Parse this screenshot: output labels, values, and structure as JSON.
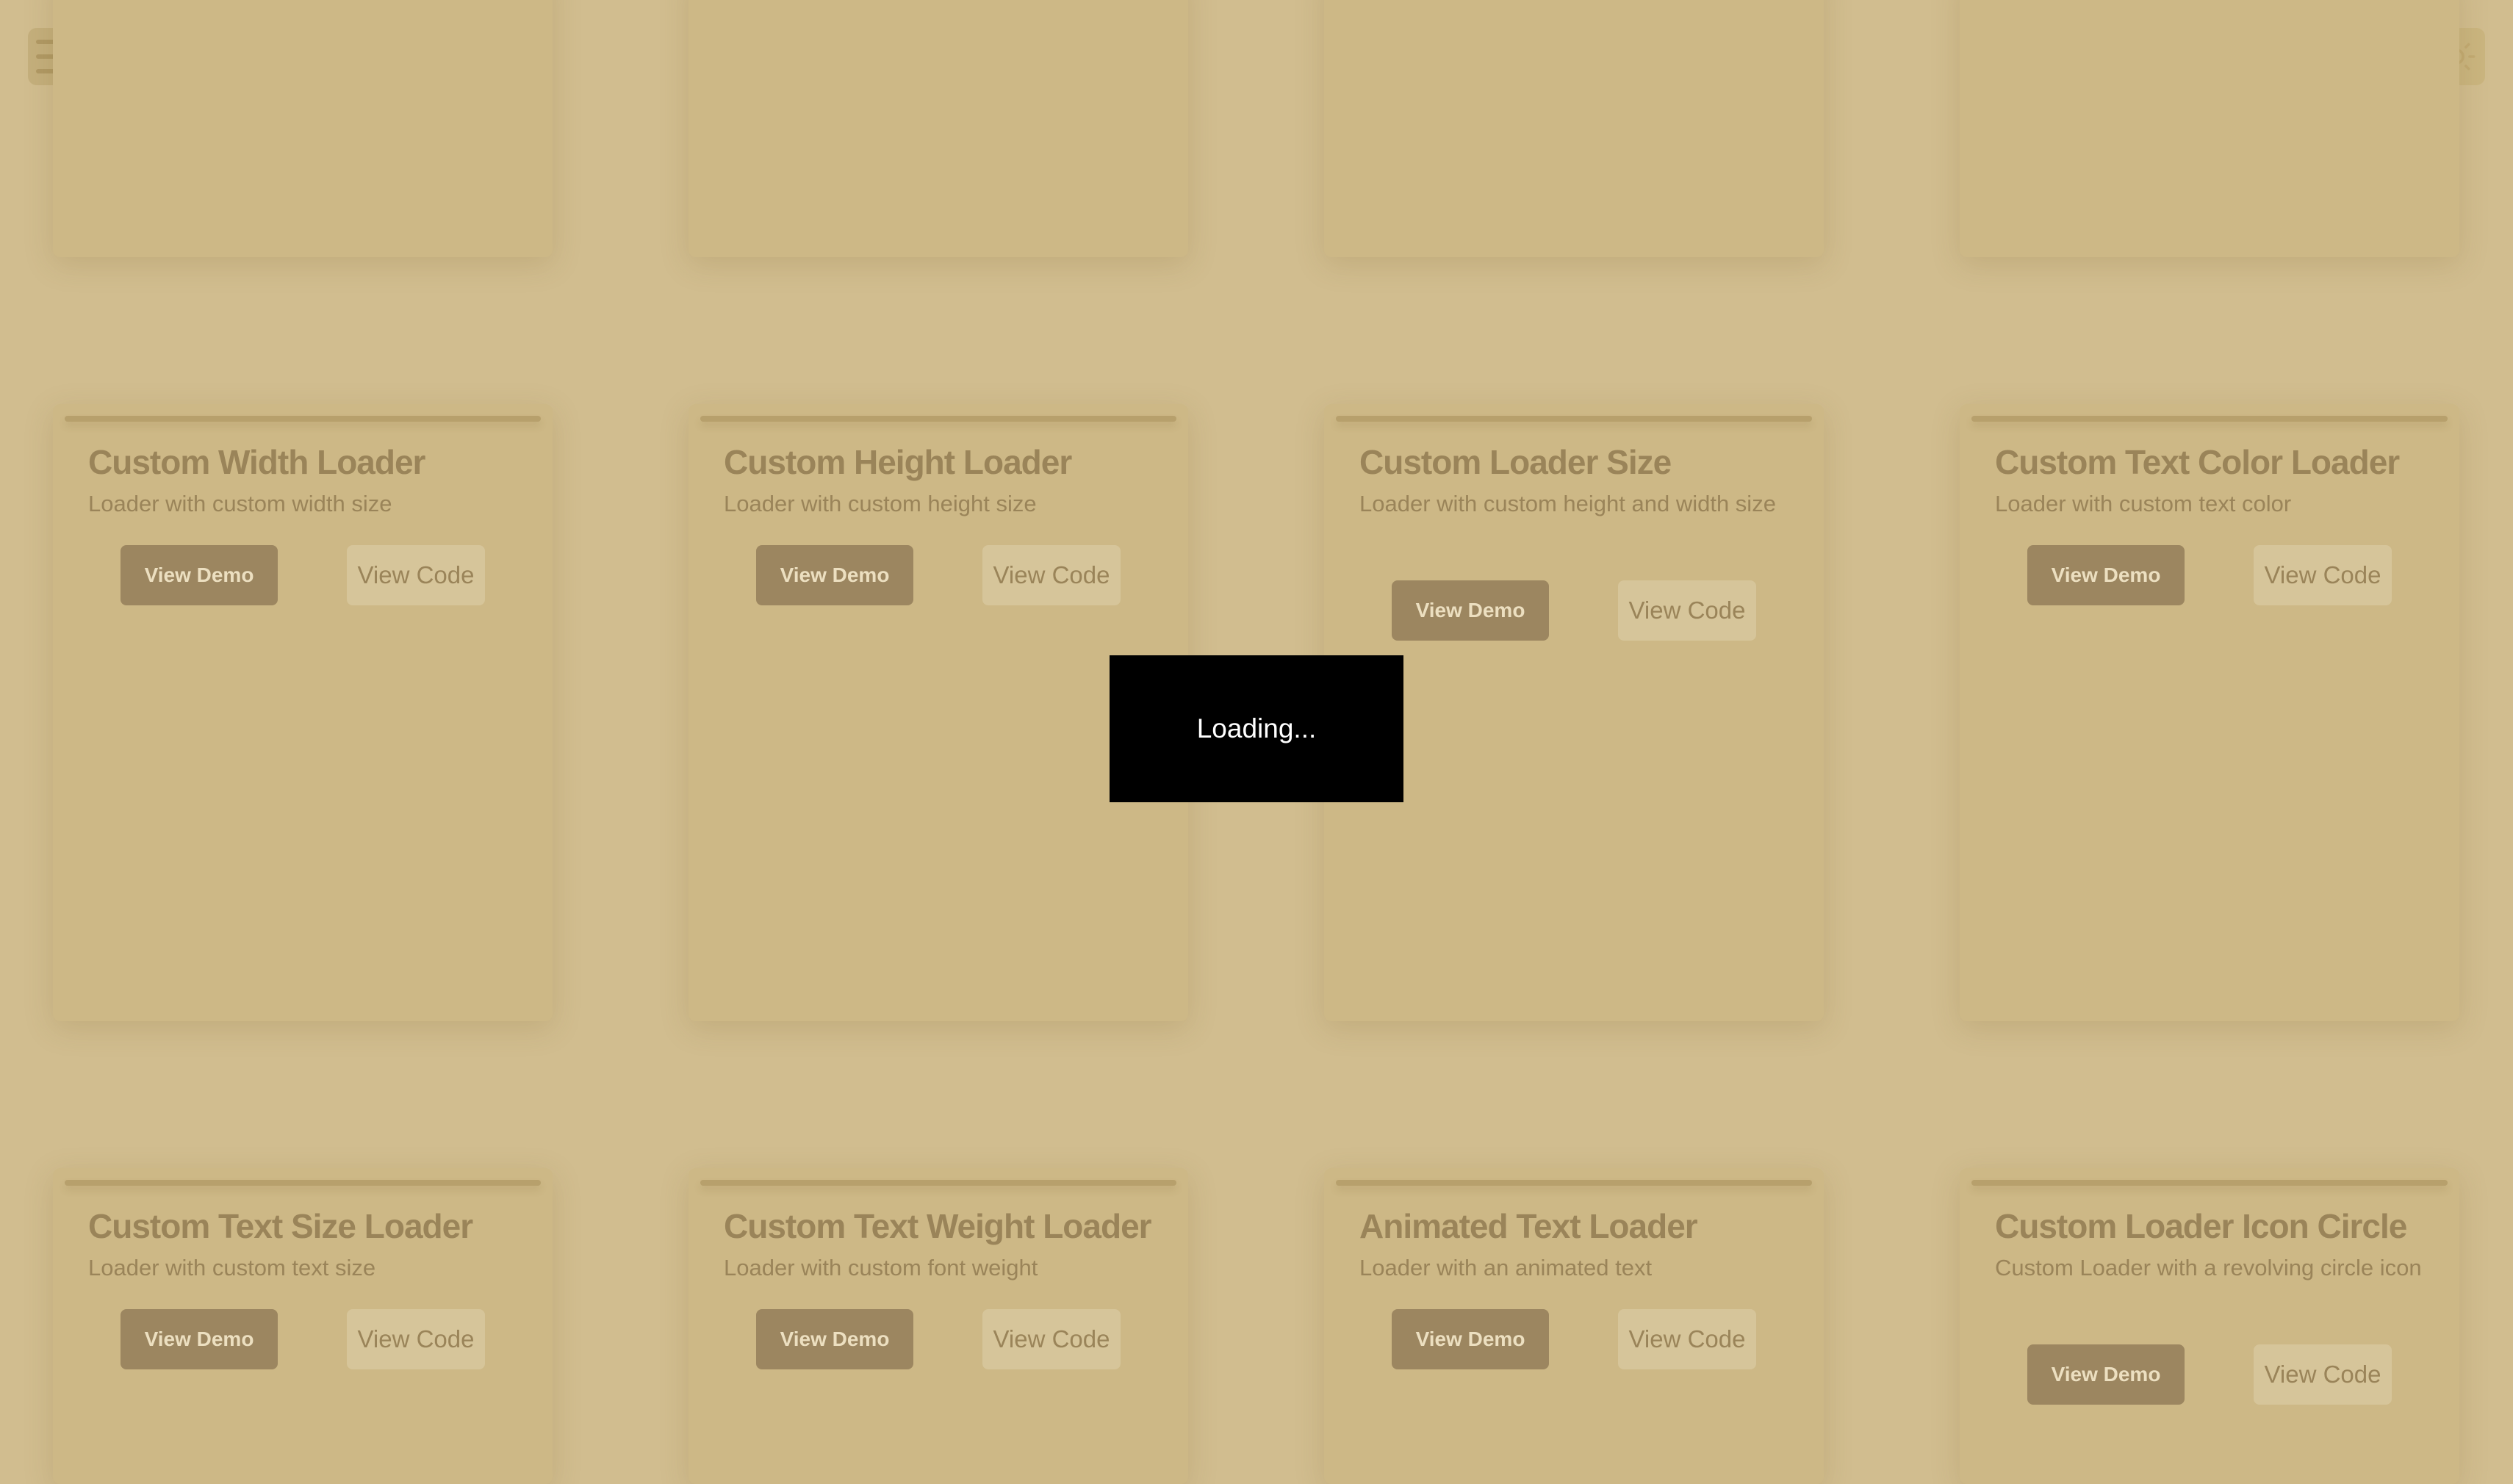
{
  "theme": {
    "background": "#d1bd8f",
    "card": "#cdb886",
    "primary_button": "#9c8660",
    "secondary_button": "#d6c59a",
    "text": "#9a8459",
    "overlay": "#000000"
  },
  "header": {
    "menu_icon": "hamburger-menu-icon",
    "theme_icon": "sun-icon"
  },
  "cards": [
    {},
    {},
    {},
    {},
    {
      "title": "Custom Width Loader",
      "description": "Loader with custom width size",
      "demo_label": "View Demo",
      "code_label": "View Code"
    },
    {
      "title": "Custom Height Loader",
      "description": "Loader with custom height size",
      "demo_label": "View Demo",
      "code_label": "View Code"
    },
    {
      "title": "Custom Loader Size",
      "description": "Loader with custom height and width size",
      "demo_label": "View Demo",
      "code_label": "View Code"
    },
    {
      "title": "Custom Text Color Loader",
      "description": "Loader with custom text color",
      "demo_label": "View Demo",
      "code_label": "View Code"
    },
    {
      "title": "Custom Text Size Loader",
      "description": "Loader with custom text size",
      "demo_label": "View Demo",
      "code_label": "View Code"
    },
    {
      "title": "Custom Text Weight Loader",
      "description": "Loader with custom font weight",
      "demo_label": "View Demo",
      "code_label": "View Code"
    },
    {
      "title": "Animated Text Loader",
      "description": "Loader with an animated text",
      "demo_label": "View Demo",
      "code_label": "View Code"
    },
    {
      "title": "Custom Loader Icon Circle",
      "description": "Custom Loader with a revolving circle icon",
      "demo_label": "View Demo",
      "code_label": "View Code"
    }
  ],
  "loader": {
    "text": "Loading..."
  }
}
